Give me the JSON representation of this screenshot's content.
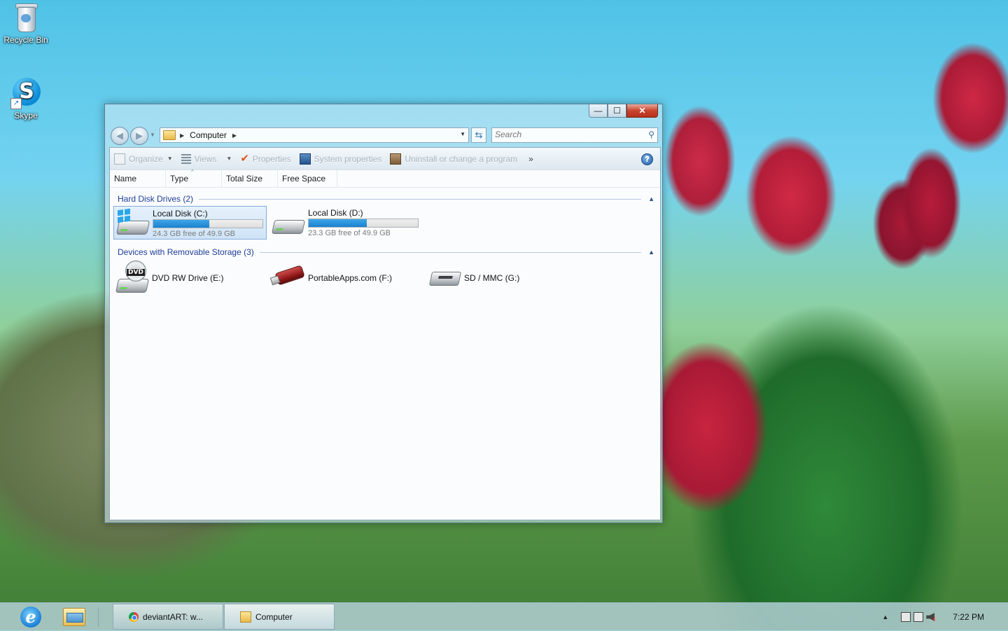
{
  "desktop": {
    "icons": [
      {
        "label": "Recycle Bin"
      },
      {
        "label": "Skype"
      }
    ]
  },
  "window": {
    "title_buttons": {
      "minimize": "—",
      "maximize": "☐",
      "close": "✕"
    },
    "address": {
      "crumb": "Computer"
    },
    "search": {
      "placeholder": "Search"
    },
    "toolbar": {
      "organize": "Organize",
      "views": "Views",
      "properties": "Properties",
      "system_properties": "System properties",
      "uninstall": "Uninstall or change a program",
      "more": "»",
      "help": "?"
    },
    "columns": [
      "Name",
      "Type",
      "Total Size",
      "Free Space"
    ],
    "groups": [
      {
        "title": "Hard Disk Drives (2)",
        "items": [
          {
            "name": "Local Disk (C:)",
            "free_text": "24.3 GB free of 49.9 GB",
            "used_fraction": 0.51,
            "icon": "hdd-windows-icon",
            "selected": true
          },
          {
            "name": "Local Disk (D:)",
            "free_text": "23.3 GB free of 49.9 GB",
            "used_fraction": 0.53,
            "icon": "hdd-icon",
            "selected": false
          }
        ]
      },
      {
        "title": "Devices with Removable Storage (3)",
        "items": [
          {
            "name": "DVD RW Drive (E:)",
            "icon": "dvd-drive-icon"
          },
          {
            "name": "PortableApps.com (F:)",
            "icon": "usb-drive-icon"
          },
          {
            "name": "SD / MMC (G:)",
            "icon": "sd-card-icon"
          }
        ]
      }
    ]
  },
  "taskbar": {
    "buttons": [
      {
        "label": "deviantART: w...",
        "icon": "chrome-icon"
      },
      {
        "label": "Computer",
        "icon": "folder-icon"
      }
    ],
    "clock": "7:22 PM",
    "tray_up": "▲"
  },
  "colors": {
    "accent": "#1e3d9a",
    "bar_fill": "#26a0da",
    "close_button": "#c9452e"
  }
}
